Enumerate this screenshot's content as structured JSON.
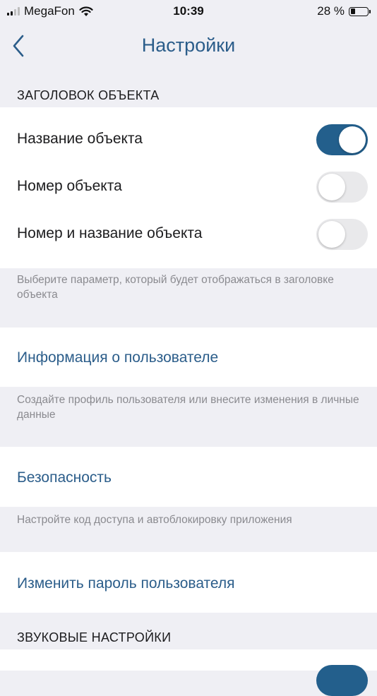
{
  "status_bar": {
    "carrier": "MegaFon",
    "time": "10:39",
    "battery_percent": "28 %",
    "battery_level": 0.28,
    "signal_bars": 2,
    "icons": [
      "signal-icon",
      "wifi-icon",
      "battery-icon"
    ]
  },
  "nav": {
    "title": "Настройки",
    "back_icon": "chevron-left-icon"
  },
  "object_header": {
    "section_title": "ЗАГОЛОВОК ОБЪЕКТА",
    "options": [
      {
        "label": "Название объекта",
        "enabled": true
      },
      {
        "label": "Номер объекта",
        "enabled": false
      },
      {
        "label": "Номер и название объекта",
        "enabled": false
      }
    ],
    "footer": "Выберите параметр, который будет отображаться в заголовке объекта"
  },
  "user_info": {
    "label": "Информация о пользователе",
    "footer": "Создайте профиль пользователя или внесите изменения в личные данные"
  },
  "security": {
    "label": "Безопасность",
    "footer": "Настройте код доступа и автоблокировку приложения"
  },
  "change_password": {
    "label": "Изменить пароль пользователя"
  },
  "sound_settings": {
    "section_title": "ЗВУКОВЫЕ НАСТРОЙКИ"
  },
  "colors": {
    "accent": "#2b5d8a",
    "toggle_on": "#235f8c",
    "toggle_off": "#e9e9eb",
    "background": "#efeff4",
    "footer_text": "#8a8a8f"
  }
}
